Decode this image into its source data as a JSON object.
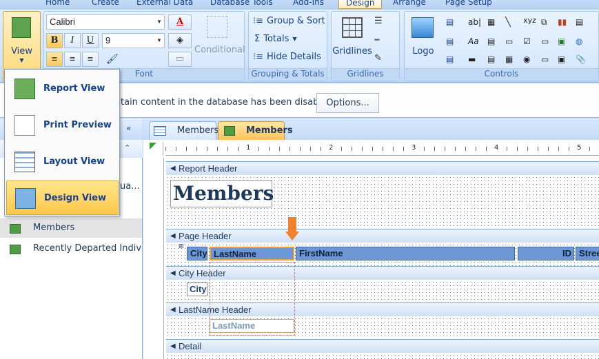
{
  "ribbon_tabs": [
    "Home",
    "Create",
    "External Data",
    "Database Tools",
    "Add-Ins",
    "Design",
    "Arrange",
    "Page Setup"
  ],
  "view_button": {
    "label": "View"
  },
  "font": {
    "name": "Calibri",
    "size": "9",
    "group_label": "Font",
    "conditional_label": "Conditional"
  },
  "grouping": {
    "group_sort": "Group & Sort",
    "totals": "Totals",
    "hide_details": "Hide Details",
    "group_label": "Grouping & Totals"
  },
  "gridlines": {
    "label": "Gridlines",
    "group_label": "Gridlines"
  },
  "controls": {
    "logo": "Logo",
    "group_label": "Controls"
  },
  "view_menu": {
    "items": [
      {
        "label": "Report View"
      },
      {
        "label": "Print Preview"
      },
      {
        "label": "Layout View"
      },
      {
        "label": "Design View"
      }
    ]
  },
  "message_bar": {
    "text": "tain content in the database has been disabled",
    "options_label": "Options..."
  },
  "nav": {
    "partial_item": "ua...",
    "items": [
      "Members",
      "Recently Departed Indivi..."
    ]
  },
  "doc_tabs": [
    "Members",
    "Members"
  ],
  "ruler": {
    "marks": [
      "1",
      "2",
      "3",
      "4",
      "5"
    ]
  },
  "report": {
    "sections": [
      "Report Header",
      "Page Header",
      "City Header",
      "LastName Header",
      "Detail"
    ],
    "title": "Members",
    "page_header_fields": [
      "City",
      "LastName",
      "FirstName",
      "ID",
      "Stree"
    ],
    "city_field": "City",
    "lastname_field": "LastName"
  },
  "colors": {
    "accent": "#ffc74a",
    "section": "#cfdff3",
    "control": "#6c97d4"
  }
}
